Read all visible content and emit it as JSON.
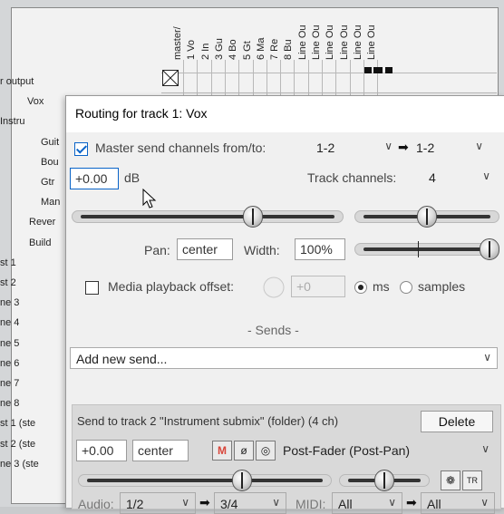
{
  "matrix": {
    "columns": [
      "master/",
      "1 Vo",
      "2 In",
      "3 Gu",
      "4 Bo",
      "5 Gt",
      "6 Ma",
      "7 Re",
      "8 Bu",
      "Line Ou",
      "Line Ou",
      "Line Ou",
      "Line Ou",
      "Line Ou",
      "Line Ou"
    ],
    "rows": [
      "r output",
      "Vox",
      "Instru",
      "Guit",
      "Bou",
      "Gtr",
      "Man",
      "Rever",
      "Build",
      "st 1",
      "st 2",
      "ne 3",
      "ne 4",
      "ne 5",
      "ne 6",
      "ne 7",
      "ne 8",
      "st 1 (ste",
      "st 2 (ste",
      "ne 3 (ste"
    ]
  },
  "window": {
    "title": "Routing for track 1: Vox",
    "master_send_label": "Master send channels from/to:",
    "master_send_checked": true,
    "from_channels": "1-2",
    "to_channels": "1-2",
    "arrow_glyph": "➡",
    "volume_value": "+0.00",
    "volume_unit": "dB",
    "track_channels_label": "Track channels:",
    "track_channels_value": "4",
    "pan_label": "Pan:",
    "pan_value": "center",
    "width_label": "Width:",
    "width_value": "100%",
    "media_offset_label": "Media playback offset:",
    "media_offset_checked": false,
    "media_offset_value": "+0",
    "ms_label": "ms",
    "samples_label": "samples",
    "offset_unit_selected": "ms",
    "sends_header": "- Sends -",
    "add_send_label": "Add new send...",
    "volume_slider_level": 0.68,
    "pan_slider_level": 0.5,
    "width_slider_level": 1.0,
    "send": {
      "title": "Send to track 2 \"Instrument submix\" (folder) (4 ch)",
      "delete_label": "Delete",
      "volume": "+0.00",
      "pan": "center",
      "mute_label": "M",
      "phase_label": "ø",
      "mono_label": "◎",
      "mode": "Post-Fader (Post-Pan)",
      "audio_label": "Audio:",
      "audio_from": "1/2",
      "audio_to": "3/4",
      "midi_label": "MIDI:",
      "midi_from": "All",
      "midi_to": "All",
      "volume_slider_level": 0.66,
      "pan_slider_level": 0.5
    }
  },
  "colors": {
    "accent": "#0a64c8",
    "mute_active": "#d8453a"
  },
  "icons": [
    "checkbox-icon",
    "dropdown-arrow-icon",
    "arrow-right-icon",
    "knob-icon",
    "mouse-cursor-icon",
    "fx-icon",
    "tr-icon"
  ]
}
